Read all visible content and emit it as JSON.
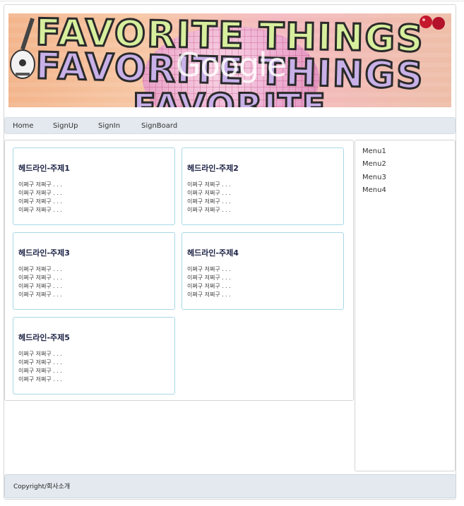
{
  "banner": {
    "headline_1": "FAVORITE THINGS",
    "headline_2": "FAVORITE THINGS",
    "headline_3": "FAVORITE",
    "logo_text": "Google"
  },
  "nav": {
    "items": [
      {
        "label": "Home"
      },
      {
        "label": "SignUp"
      },
      {
        "label": "SignIn"
      },
      {
        "label": "SignBoard"
      }
    ]
  },
  "cards": [
    {
      "title": "헤드라인-주제1",
      "lines": [
        "이쩌구 저쩌구 . . .",
        "이쩌구 저쩌구 . . .",
        "이쩌구 저쩌구 . . .",
        "이쩌구 저쩌구 . . ."
      ]
    },
    {
      "title": "헤드라인-주제2",
      "lines": [
        "이쩌구 저쩌구 . . .",
        "이쩌구 저쩌구 . . .",
        "이쩌구 저쩌구 . . .",
        "이쩌구 저쩌구 . . ."
      ]
    },
    {
      "title": "헤드라인-주제3",
      "lines": [
        "이쩌구 저쩌구 . . .",
        "이쩌구 저쩌구 . . .",
        "이쩌구 저쩌구 . . .",
        "이쩌구 저쩌구 . . ."
      ]
    },
    {
      "title": "헤드라인-주제4",
      "lines": [
        "이쩌구 저쩌구 . . .",
        "이쩌구 저쩌구 . . .",
        "이쩌구 저쩌구 . . .",
        "이쩌구 저쩌구 . . ."
      ]
    },
    {
      "title": "헤드라인-주제5",
      "lines": [
        "이쩌구 저쩌구 . . .",
        "이쩌구 저쩌구 . . .",
        "이쩌구 저쩌구 . . .",
        "이쩌구 저쩌구 . . ."
      ]
    }
  ],
  "sidebar": {
    "items": [
      {
        "label": "Menu1"
      },
      {
        "label": "Menu2"
      },
      {
        "label": "Menu3"
      },
      {
        "label": "Menu4"
      }
    ]
  },
  "footer": {
    "text": "Copyright/회사소개"
  },
  "colors": {
    "nav_bg": "#e3e9ef",
    "card_border": "#a7d8e6",
    "card_title": "#1f2547"
  }
}
